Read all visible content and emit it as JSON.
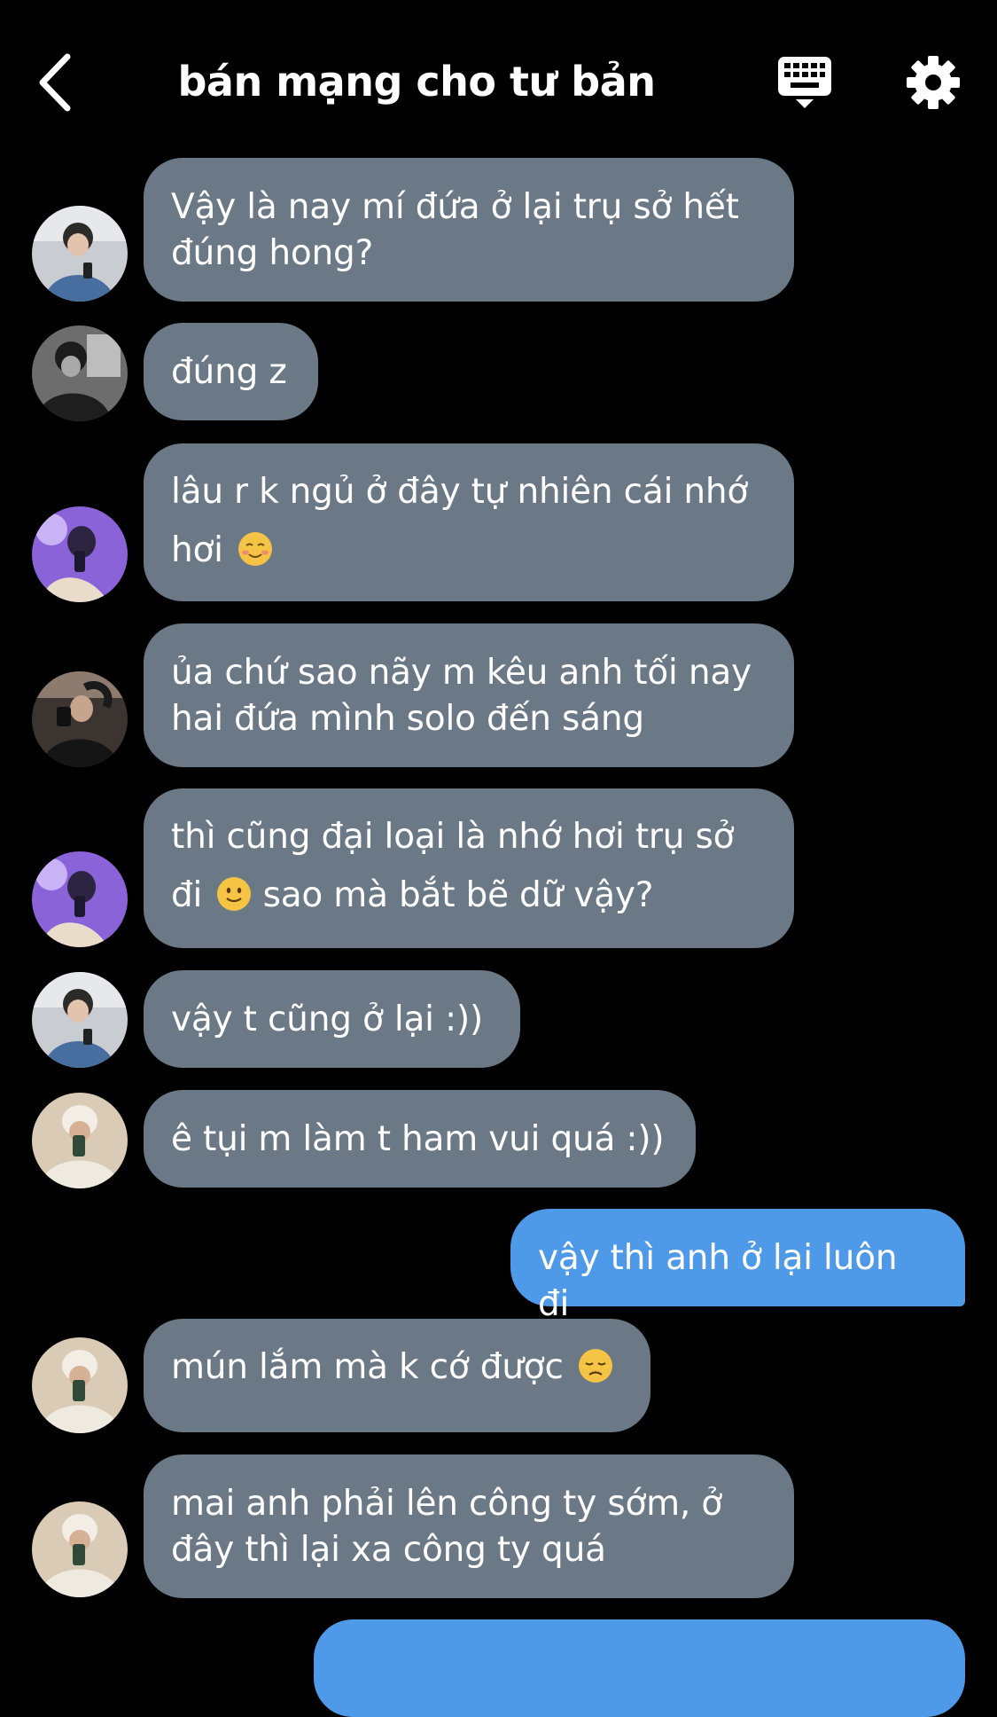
{
  "header": {
    "title": "bán mạng cho tư bản",
    "back_icon": "chevron-left-icon",
    "keyboard_icon": "keyboard-icon",
    "settings_icon": "gear-icon"
  },
  "colors": {
    "background": "#000000",
    "incoming_bubble": "#6b7885",
    "outgoing_bubble": "#4f9ae8",
    "text": "#ffffff"
  },
  "messages": [
    {
      "sender": "avatar-1",
      "direction": "incoming",
      "text": "Vậy là nay mí đứa ở lại trụ sở hết đúng hong?"
    },
    {
      "sender": "avatar-2",
      "direction": "incoming",
      "text": "đúng z"
    },
    {
      "sender": "avatar-3",
      "direction": "incoming",
      "text": "lâu r k ngủ ở đây tự nhiên cái nhớ hơi",
      "emoji": "smiling-face-icon"
    },
    {
      "sender": "avatar-4",
      "direction": "incoming",
      "text": "ủa chứ sao nãy m kêu anh tối nay hai đứa mình solo đến sáng"
    },
    {
      "sender": "avatar-3",
      "direction": "incoming",
      "text_a": "thì cũng đại loại là nhớ hơi trụ sở",
      "text_b_pre": "đi",
      "text_b_post": "sao mà bắt bẽ dữ vậy?",
      "emoji": "slightly-smiling-face-icon"
    },
    {
      "sender": "avatar-1",
      "direction": "incoming",
      "text": "vậy t cũng ở lại :))"
    },
    {
      "sender": "avatar-5",
      "direction": "incoming",
      "text": "ê tụi m làm t ham vui quá :))"
    },
    {
      "sender": "me",
      "direction": "outgoing",
      "text": "vậy thì anh ở lại luôn đi"
    },
    {
      "sender": "avatar-5",
      "direction": "incoming",
      "text": "mún lắm mà k cớ được",
      "emoji": "disappointed-face-icon"
    },
    {
      "sender": "avatar-5",
      "direction": "incoming",
      "text": "mai anh phải lên công ty sớm, ở đây thì lại xa công ty quá"
    },
    {
      "sender": "me",
      "direction": "outgoing",
      "text": ""
    }
  ]
}
